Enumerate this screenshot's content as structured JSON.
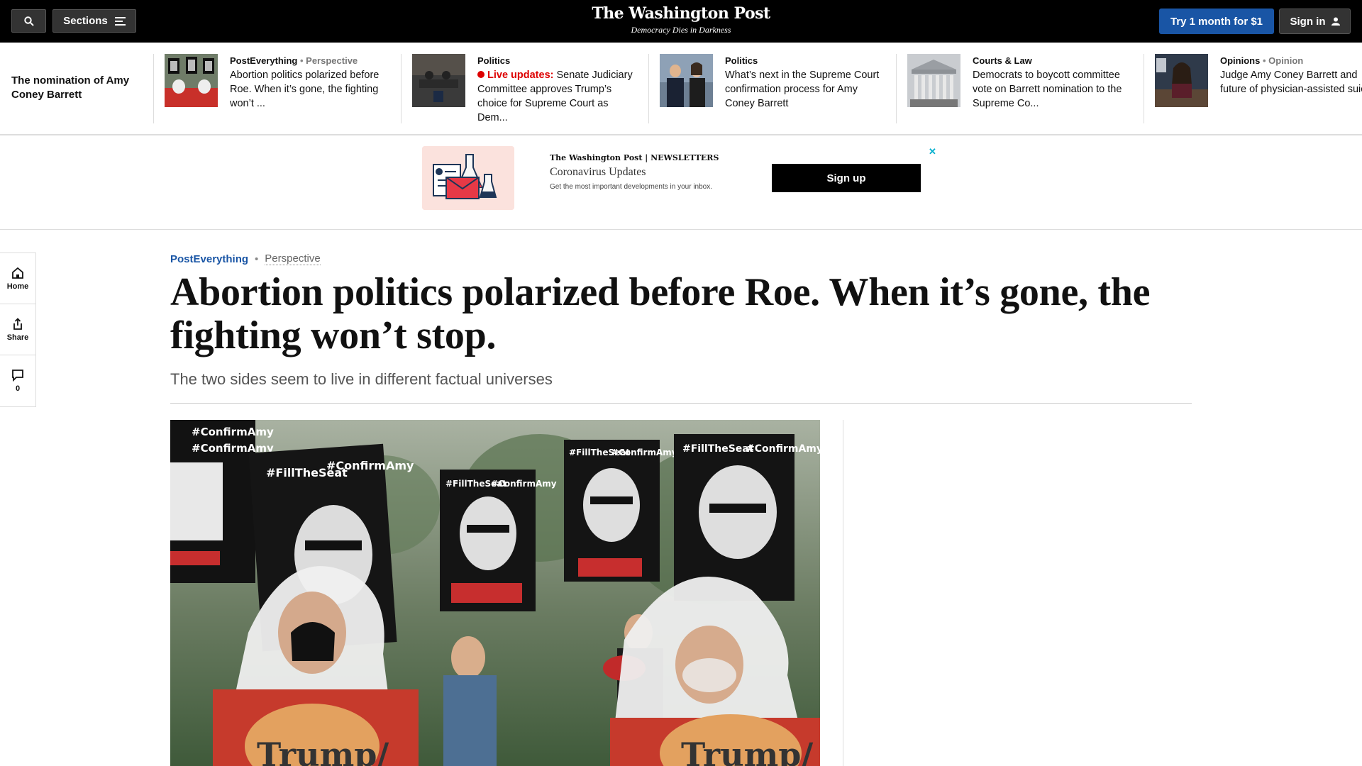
{
  "topnav": {
    "sections_label": "Sections",
    "logo": "The Washington Post",
    "tagline": "Democracy Dies in Darkness",
    "try_label": "Try 1 month for $1",
    "signin_label": "Sign in"
  },
  "strip": {
    "label": "The nomination of Amy Coney Barrett",
    "items": [
      {
        "kicker": "PostEverything",
        "tag": "Perspective",
        "headline": "Abortion politics polarized before Roe. When it’s gone, the fighting won’t ..."
      },
      {
        "kicker": "Politics",
        "live": "Live updates:",
        "headline": "Senate Judiciary Committee approves Trump’s choice for Supreme Court as Dem..."
      },
      {
        "kicker": "Politics",
        "headline": "What’s next in the Supreme Court confirmation process for Amy Coney Barrett"
      },
      {
        "kicker": "Courts & Law",
        "headline": "Democrats to boycott committee vote on Barrett nomination to the Supreme Co..."
      },
      {
        "kicker": "Opinions",
        "tag": "Opinion",
        "headline": "Judge Amy Coney Barrett and future of physician-assisted suicide"
      }
    ]
  },
  "ad": {
    "brand": "The Washington Post | NEWSLETTERS",
    "title": "Coronavirus Updates",
    "desc": "Get the most important developments in your inbox.",
    "signup_label": "Sign up",
    "close": "✕"
  },
  "rail": {
    "home": "Home",
    "share": "Share",
    "comments": "0"
  },
  "article": {
    "section": "PostEverything",
    "dot": "•",
    "perspective": "Perspective",
    "headline": "Abortion politics polarized before Roe. When it’s gone, the fighting won’t stop.",
    "dek": "The two sides seem to live in different factual universes"
  },
  "photo": {
    "sign_texts": [
      "#ConfirmAmy",
      "#FillTheSeat"
    ],
    "apron_text": "Trump/"
  },
  "colors": {
    "accent_blue": "#1955a5",
    "live_red": "#dd0000",
    "nav_black": "#000000"
  }
}
